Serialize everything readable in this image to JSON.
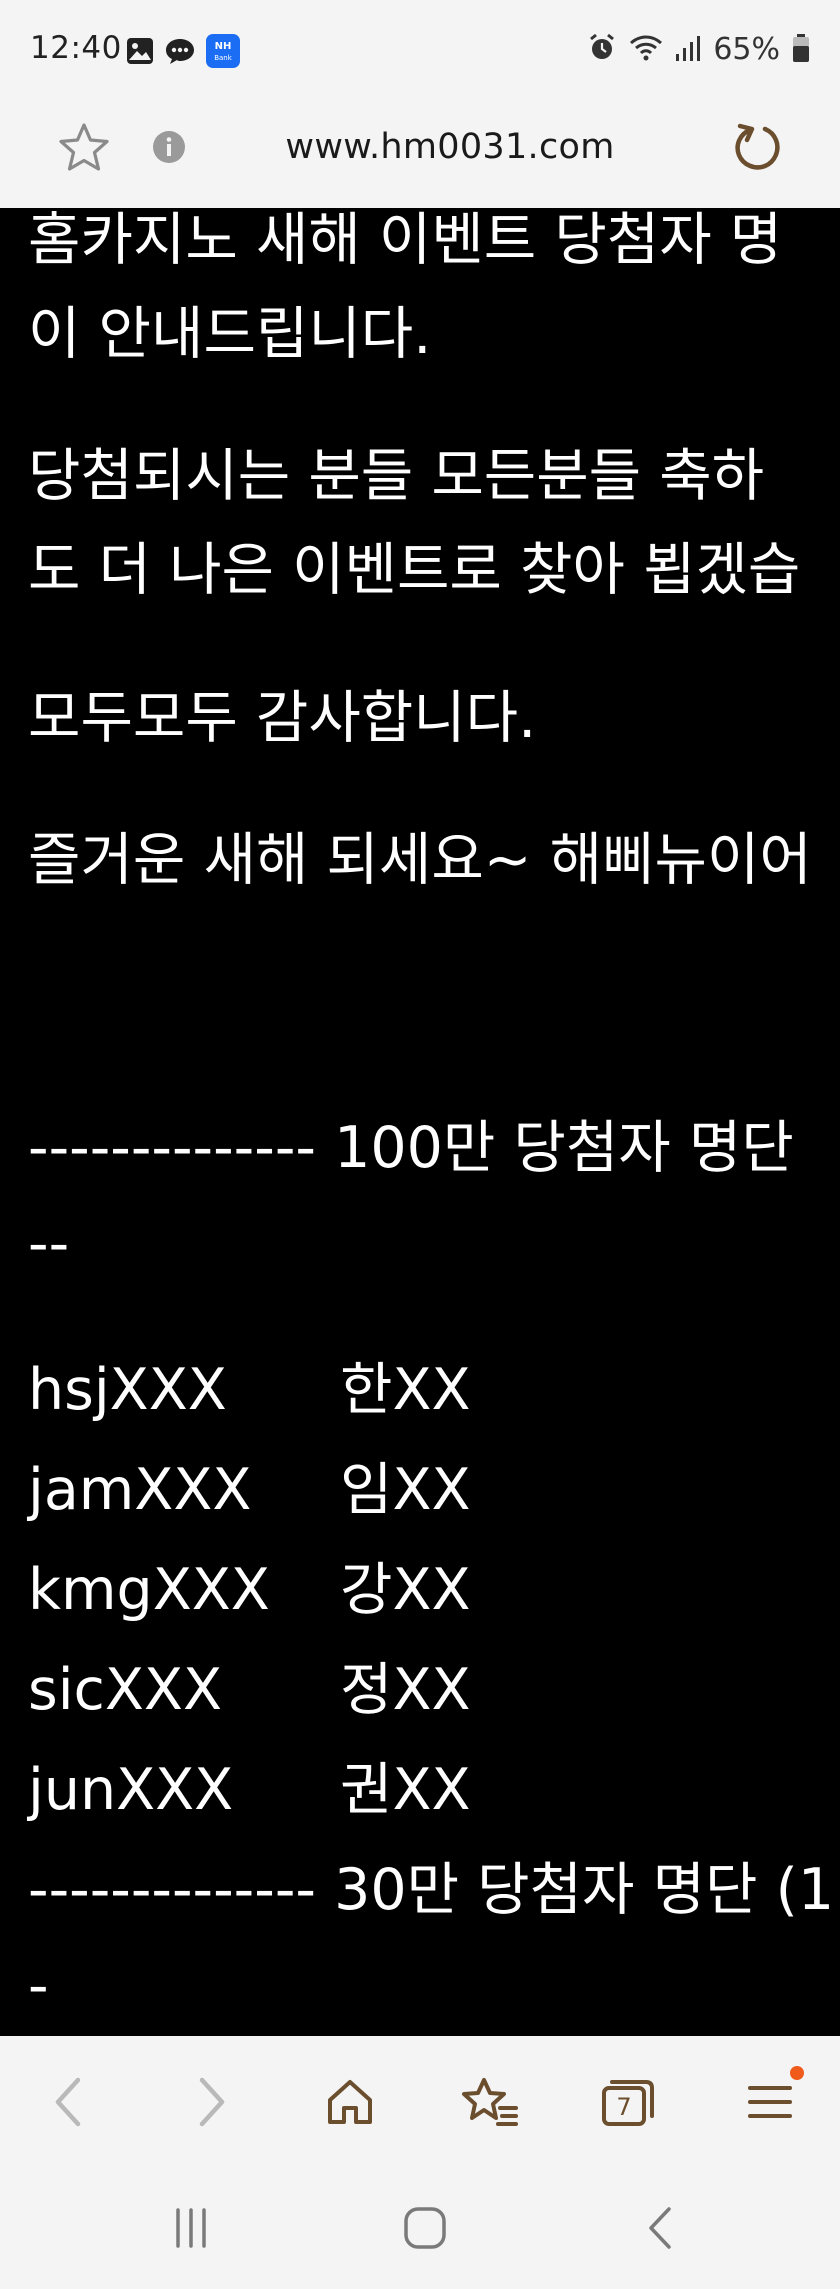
{
  "status_bar": {
    "time": "12:40",
    "battery": "65%",
    "left_icons": [
      "gallery-icon",
      "chat-icon",
      "nh-bank-icon"
    ],
    "nh_bank_label_top": "NH",
    "nh_bank_label_bottom": "Bank",
    "right_icons": [
      "alarm-icon",
      "wifi-icon",
      "signal-icon",
      "battery-icon"
    ]
  },
  "url_bar": {
    "url": "www.hm0031.com",
    "accent_color": "#6b4e2e"
  },
  "content": {
    "lines": [
      "홈카지노 새해 이벤트 당첨자 명",
      "이 안내드립니다.",
      "당첨되시는 분들 모든분들 축하",
      "도 더 나은 이벤트로 찾아 뵙겠습",
      "모두모두 감사합니다.",
      "즐거운 새해 되세요~ 해삐뉴이어",
      "-------------- 100만 당첨자 명단",
      "--",
      "-------------- 30만 당첨자 명단 (1",
      "-"
    ],
    "winners_100": [
      {
        "id": "hsjXXX",
        "name": "한XX"
      },
      {
        "id": "jamXXX",
        "name": "임XX"
      },
      {
        "id": "kmgXXX",
        "name": "강XX"
      },
      {
        "id": "sicXXX",
        "name": "정XX"
      },
      {
        "id": "junXXX",
        "name": "권XX"
      }
    ]
  },
  "toolbar": {
    "buttons": [
      "back-icon",
      "forward-icon",
      "home-icon",
      "bookmarks-icon",
      "tabs-icon",
      "menu-icon"
    ],
    "tab_count": "7",
    "notification_color": "#f05a1a"
  },
  "navbar": {
    "buttons": [
      "recents-icon",
      "home-circle-icon",
      "back-nav-icon"
    ]
  }
}
